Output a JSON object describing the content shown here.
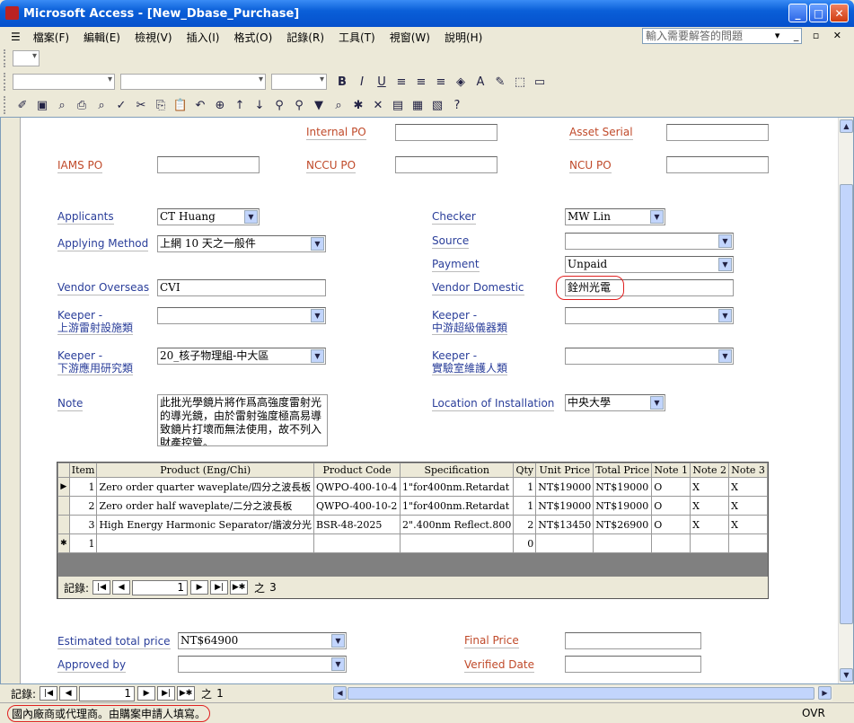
{
  "window": {
    "title": "Microsoft Access - [New_Dbase_Purchase]"
  },
  "menu": [
    "檔案(F)",
    "編輯(E)",
    "檢視(V)",
    "插入(I)",
    "格式(O)",
    "記錄(R)",
    "工具(T)",
    "視窗(W)",
    "說明(H)"
  ],
  "ask_placeholder": "輸入需要解答的問題",
  "form": {
    "internal_po": {
      "label": "Internal PO",
      "value": ""
    },
    "asset_serial": {
      "label": "Asset Serial",
      "value": ""
    },
    "iams_po": {
      "label": "IAMS PO",
      "value": ""
    },
    "nccu_po": {
      "label": "NCCU PO",
      "value": ""
    },
    "ncu_po": {
      "label": "NCU PO",
      "value": ""
    },
    "applicants": {
      "label": "Applicants",
      "value": "CT Huang"
    },
    "checker": {
      "label": "Checker",
      "value": "MW Lin"
    },
    "applying_method": {
      "label": "Applying Method",
      "value": "上網 10 天之一般件"
    },
    "source": {
      "label": "Source",
      "value": ""
    },
    "payment": {
      "label": "Payment",
      "value": "Unpaid"
    },
    "vendor_overseas": {
      "label": "Vendor Overseas",
      "value": "CVI"
    },
    "vendor_domestic": {
      "label": "Vendor Domestic",
      "value": "銓州光電"
    },
    "keeper1": {
      "label1": "Keeper -",
      "label2": "上游雷射設施類",
      "value": ""
    },
    "keeper2": {
      "label1": "Keeper -",
      "label2": "中游超級儀器類",
      "value": ""
    },
    "keeper3": {
      "label1": "Keeper -",
      "label2": "下游應用研究類",
      "value": "20_核子物理組-中大區"
    },
    "keeper4": {
      "label1": "Keeper -",
      "label2": "實驗室維護人類",
      "value": ""
    },
    "note": {
      "label": "Note",
      "value": "此批光學鏡片將作爲高強度雷射光的導光鏡，由於雷射強度極高易導致鏡片打壞而無法使用，故不列入財產控管。"
    },
    "location": {
      "label": "Location of Installation",
      "value": "中央大學"
    },
    "estimated_total": {
      "label": "Estimated total price",
      "value": "NT$64900"
    },
    "final_price": {
      "label": "Final Price",
      "value": ""
    },
    "approved_by": {
      "label": "Approved by",
      "value": ""
    },
    "verified_date": {
      "label": "Verified Date",
      "value": ""
    }
  },
  "grid": {
    "headers": [
      "Item",
      "Product (Eng/Chi)",
      "Product Code",
      "Specification",
      "Qty",
      "Unit Price",
      "Total Price",
      "Note 1",
      "Note 2",
      "Note 3"
    ],
    "rows": [
      [
        "1",
        "Zero order quarter waveplate/四分之波長板",
        "QWPO-400-10-4",
        "1\"for400nm.Retardat",
        "1",
        "NT$19000",
        "NT$19000",
        "O",
        "X",
        "X"
      ],
      [
        "2",
        "Zero order half waveplate/二分之波長板",
        "QWPO-400-10-2",
        "1\"for400nm.Retardat",
        "1",
        "NT$19000",
        "NT$19000",
        "O",
        "X",
        "X"
      ],
      [
        "3",
        "High Energy Harmonic Separator/諧波分光",
        "BSR-48-2025",
        "2\".400nm Reflect.800",
        "2",
        "NT$13450",
        "NT$26900",
        "O",
        "X",
        "X"
      ],
      [
        "1",
        "",
        "",
        "",
        "0",
        "",
        "",
        "",
        "",
        ""
      ]
    ],
    "nav": {
      "label": "記錄:",
      "current": "1",
      "of": "之",
      "total": "3"
    }
  },
  "outer_nav": {
    "label": "記錄:",
    "current": "1",
    "of": "之",
    "total": "1"
  },
  "status": {
    "text": "國內廠商或代理商。由購案申請人填寫。",
    "mode": "OVR"
  }
}
